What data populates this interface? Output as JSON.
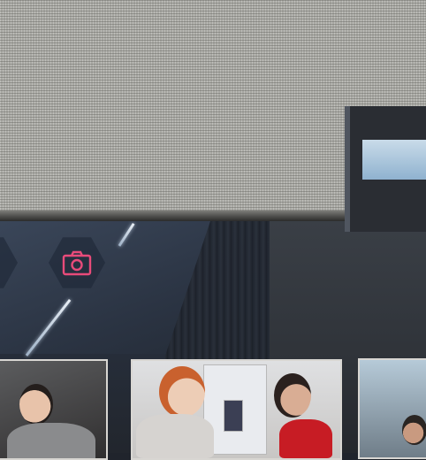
{
  "page": {
    "background_top": "#a9a9a4",
    "background_scene": "#2d3848"
  },
  "nav": {
    "buttons": [
      {
        "icon": "chevron-icon"
      },
      {
        "icon": "camera-icon",
        "color": "#e84b7a"
      }
    ]
  },
  "gallery": {
    "photos": [
      {
        "icon": "photo-thumbnail"
      },
      {
        "icon": "photo-thumbnail"
      },
      {
        "icon": "photo-thumbnail"
      }
    ]
  }
}
